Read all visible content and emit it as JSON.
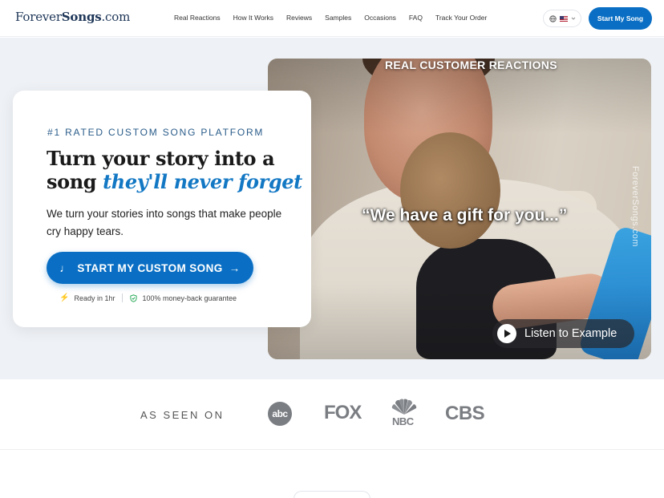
{
  "header": {
    "logo_prefix": "Forever",
    "logo_bold": "Songs",
    "logo_suffix": ".com",
    "nav": [
      "Real Reactions",
      "How It Works",
      "Reviews",
      "Samples",
      "Occasions",
      "FAQ",
      "Track Your Order"
    ],
    "language_icon": "globe-icon",
    "flag": "us-flag",
    "cta_label": "Start My Song"
  },
  "hero": {
    "eyebrow": "#1 RATED CUSTOM SONG PLATFORM",
    "headline_plain": "Turn your story into a song ",
    "headline_accent": "they'll never forget",
    "subtext": "We turn your stories into songs that make people cry happy tears.",
    "cta_label": "START MY CUSTOM SONG",
    "perk_1": "Ready in 1hr",
    "perk_2": "100% money-back guarantee",
    "accent_color": "#0a6fc4"
  },
  "video": {
    "title": "REAL CUSTOMER REACTIONS",
    "caption": "“We have a gift for you...”",
    "watermark": "ForeverSongs.com",
    "listen_label": "Listen to Example"
  },
  "press": {
    "label": "AS SEEN ON",
    "abc": "abc",
    "fox": "FOX",
    "nbc": "NBC",
    "cbs": "CBS"
  }
}
